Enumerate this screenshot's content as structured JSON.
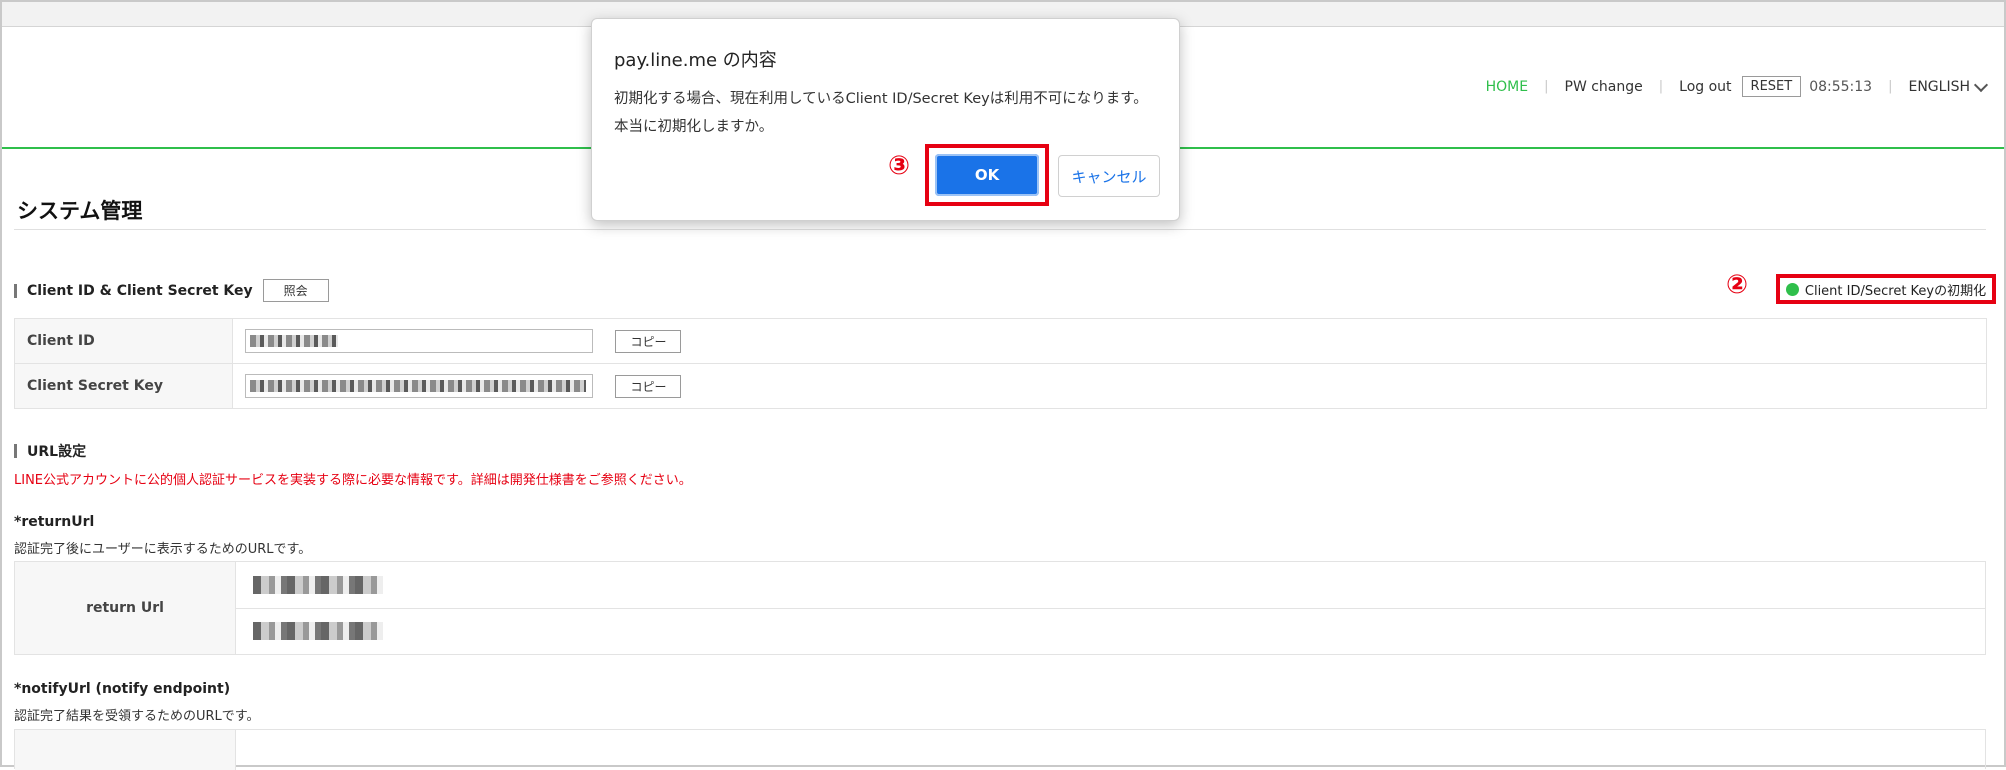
{
  "dialog": {
    "title": "pay.line.me の内容",
    "message": "初期化する場合、現在利用しているClient ID/Secret Keyは利用不可になります。本当に初期化しますか。",
    "ok_label": "OK",
    "cancel_label": "キャンセル",
    "step_marker": "③"
  },
  "nav": {
    "home": "HOME",
    "pw_change": "PW change",
    "logout": "Log out",
    "reset": "RESET",
    "time": "08:55:13",
    "language": "ENGLISH"
  },
  "page_title": "システム管理",
  "credentials": {
    "heading": "Client ID & Client Secret Key",
    "view_button": "照会",
    "reset_key_button": "Client ID/Secret Keyの初期化",
    "step_marker": "②",
    "rows": [
      {
        "label": "Client ID",
        "copy": "コピー"
      },
      {
        "label": "Client Secret Key",
        "copy": "コピー"
      }
    ]
  },
  "url_settings": {
    "heading": "URL設定",
    "note": "LINE公式アカウントに公的個人認証サービスを実装する際に必要な情報です。詳細は開発仕様書をご参照ください。",
    "return_url": {
      "heading": "*returnUrl",
      "description": "認証完了後にユーザーに表示するためのURLです。",
      "label": "return Url"
    },
    "notify_url": {
      "heading": "*notifyUrl (notify endpoint)",
      "description": "認証完了結果を受領するためのURLです。"
    }
  },
  "colors": {
    "accent_green": "#2fbf4b",
    "highlight_red": "#e60012",
    "ok_blue": "#1a73e8"
  }
}
